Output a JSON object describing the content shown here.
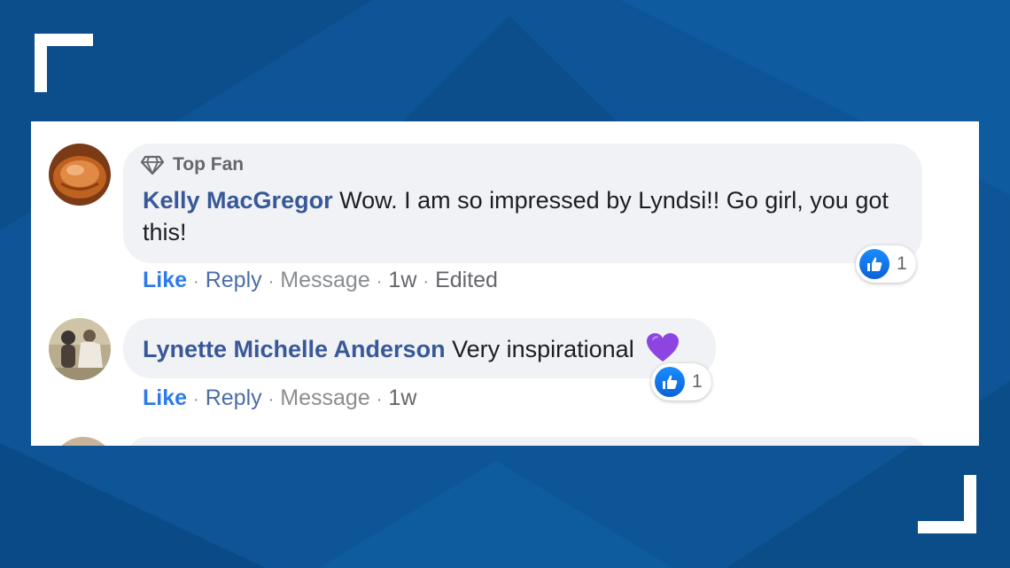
{
  "colors": {
    "background": "#0d5596",
    "card": "#ffffff",
    "bubble": "#f0f2f5",
    "author_link": "#385898",
    "like_blue": "#2e7be6",
    "meta_gray": "#65676b"
  },
  "comments": [
    {
      "badge_icon": "diamond-icon",
      "badge": "Top Fan",
      "author": "Kelly MacGregor",
      "text": "Wow. I am so impressed by Lyndsi!! Go girl, you got this!",
      "reaction_icon": "thumbs-up-icon",
      "reaction_count": "1",
      "actions": {
        "like": "Like",
        "reply": "Reply",
        "message": "Message",
        "time": "1w",
        "edited": "Edited"
      }
    },
    {
      "author": "Lynette Michelle Anderson",
      "text": "Very inspirational",
      "emoji": "purple-heart-icon",
      "reaction_icon": "thumbs-up-icon",
      "reaction_count": "1",
      "actions": {
        "like": "Like",
        "reply": "Reply",
        "message": "Message",
        "time": "1w"
      }
    }
  ]
}
